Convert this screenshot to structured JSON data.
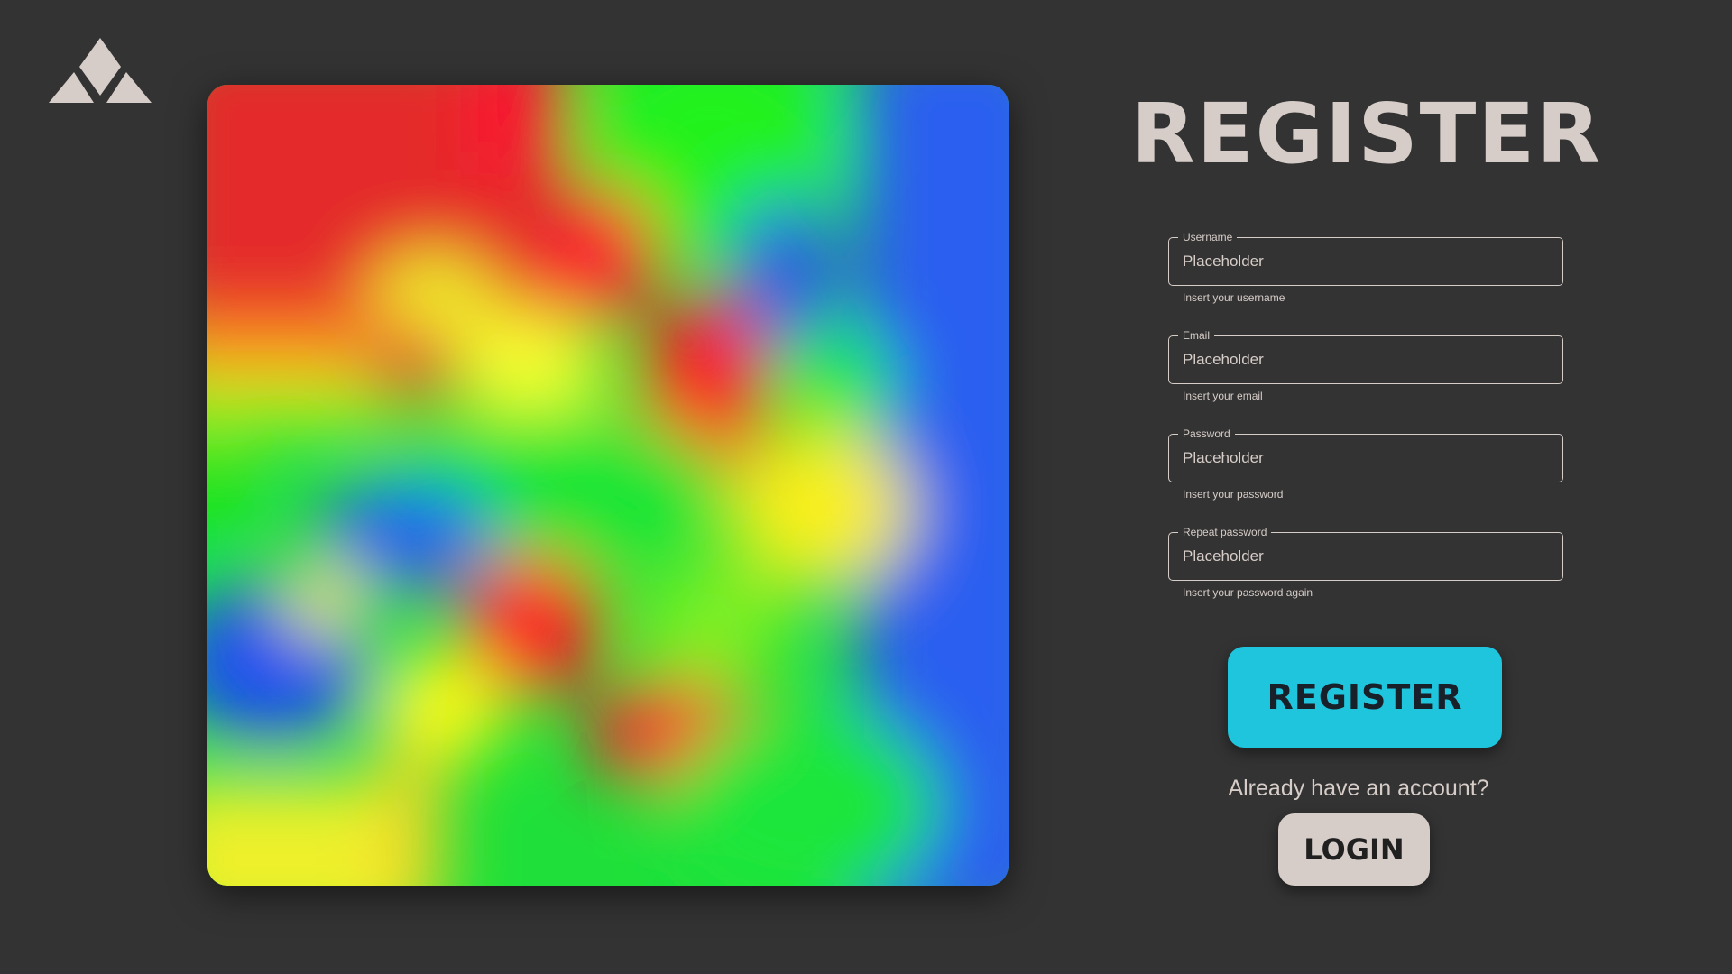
{
  "logo": {
    "icon": "triangle-mountain-logo-icon",
    "color": "#d6ccc8"
  },
  "colors": {
    "background": "#333333",
    "text": "#d6ccc8",
    "register_button": "#1fc4dd",
    "login_button": "#d6ccc8"
  },
  "hero_image": {
    "description_icon": "abstract-heatmap-image"
  },
  "form": {
    "title": "REGISTER",
    "fields": [
      {
        "label": "Username",
        "placeholder": "Placeholder",
        "value": "",
        "helper": "Insert your username"
      },
      {
        "label": "Email",
        "placeholder": "Placeholder",
        "value": "",
        "helper": "Insert your email"
      },
      {
        "label": "Password",
        "placeholder": "Placeholder",
        "value": "",
        "helper": "Insert your password"
      },
      {
        "label": "Repeat password",
        "placeholder": "Placeholder",
        "value": "",
        "helper": "Insert your password again"
      }
    ],
    "register_label": "REGISTER",
    "already_text": "Already have an account?",
    "login_label": "LOGIN"
  }
}
